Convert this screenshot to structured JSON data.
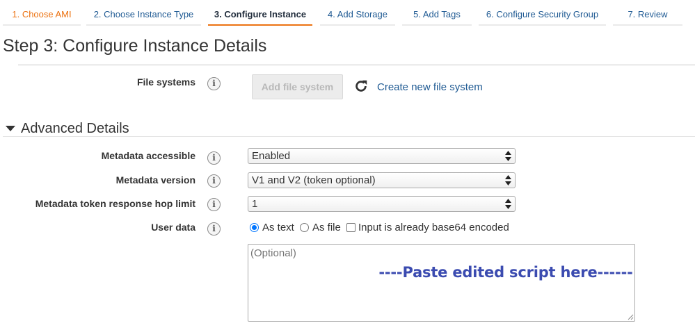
{
  "wizard": {
    "tabs": [
      {
        "label": "1. Choose AMI",
        "state": "done"
      },
      {
        "label": "2. Choose Instance Type",
        "state": "default"
      },
      {
        "label": "3. Configure Instance",
        "state": "active"
      },
      {
        "label": "4. Add Storage",
        "state": "default"
      },
      {
        "label": "5. Add Tags",
        "state": "default"
      },
      {
        "label": "6. Configure Security Group",
        "state": "default"
      },
      {
        "label": "7. Review",
        "state": "default"
      }
    ]
  },
  "page": {
    "title": "Step 3: Configure Instance Details"
  },
  "file_systems": {
    "label": "File systems",
    "add_button": "Add file system",
    "create_link": "Create new file system",
    "refresh_icon": "refresh-icon"
  },
  "advanced": {
    "title": "Advanced Details",
    "metadata_accessible": {
      "label": "Metadata accessible",
      "value": "Enabled"
    },
    "metadata_version": {
      "label": "Metadata version",
      "value": "V1 and V2 (token optional)"
    },
    "hop_limit": {
      "label": "Metadata token response hop limit",
      "value": "1"
    },
    "user_data": {
      "label": "User data",
      "options": {
        "as_text": "As text",
        "as_file": "As file",
        "base64": "Input is already base64 encoded"
      },
      "selected": "As text",
      "base64_checked": false,
      "placeholder": "(Optional)",
      "overlay_text": "----Paste edited script here------"
    }
  },
  "info_icon_glyph": "i",
  "colors": {
    "accent_orange": "#ec7211",
    "link_blue": "#1f5a93",
    "overlay_blue": "#3b4bb0",
    "radio_blue": "#0075ff"
  }
}
